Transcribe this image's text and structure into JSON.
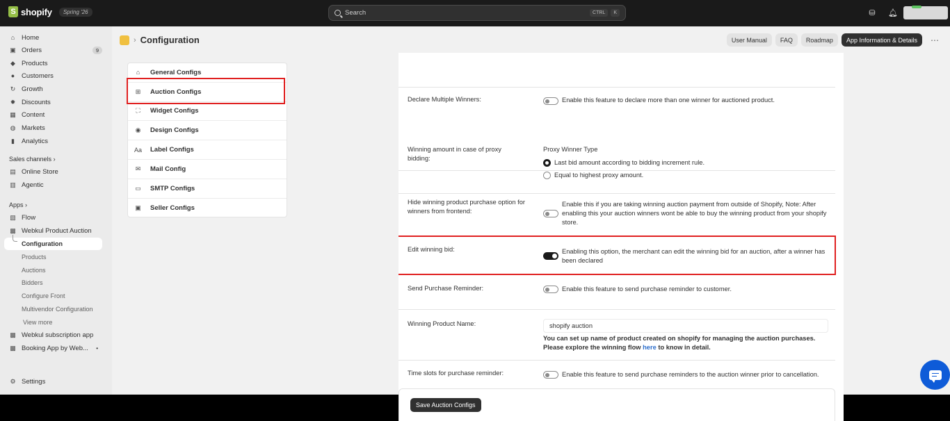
{
  "topbar": {
    "brand": "shopify",
    "edition": "Spring '26",
    "search_placeholder": "Search",
    "kbd": [
      "CTRL",
      "K"
    ]
  },
  "sidebar": {
    "items": [
      {
        "label": "Home",
        "icon": "home-icon"
      },
      {
        "label": "Orders",
        "icon": "orders-icon",
        "count": "9"
      },
      {
        "label": "Products",
        "icon": "products-icon"
      },
      {
        "label": "Customers",
        "icon": "customers-icon"
      },
      {
        "label": "Growth",
        "icon": "growth-icon"
      },
      {
        "label": "Discounts",
        "icon": "discounts-icon"
      },
      {
        "label": "Content",
        "icon": "content-icon"
      },
      {
        "label": "Markets",
        "icon": "markets-icon"
      },
      {
        "label": "Analytics",
        "icon": "analytics-icon"
      }
    ],
    "sales_channels_label": "Sales channels",
    "sales_channels": [
      {
        "label": "Online Store"
      },
      {
        "label": "Agentic"
      }
    ],
    "apps_label": "Apps",
    "apps": [
      {
        "label": "Flow"
      },
      {
        "label": "Webkul Product Auction"
      }
    ],
    "app_sub": [
      "Configuration",
      "Products",
      "Auctions",
      "Bidders",
      "Configure Front",
      "Multivendor Configuration",
      "View more"
    ],
    "other_apps": [
      {
        "label": "Webkul subscription app"
      },
      {
        "label": "Booking App by Web..."
      }
    ],
    "settings": "Settings"
  },
  "header": {
    "title": "Configuration",
    "buttons": [
      "User Manual",
      "FAQ",
      "Roadmap",
      "App Information & Details"
    ]
  },
  "config_menu": [
    {
      "label": "General Configs",
      "icon": "home-icon"
    },
    {
      "label": "Auction Configs",
      "icon": "cart-icon"
    },
    {
      "label": "Widget Configs",
      "icon": "widget-icon"
    },
    {
      "label": "Design Configs",
      "icon": "eye-icon"
    },
    {
      "label": "Label Configs",
      "icon": "label-icon"
    },
    {
      "label": "Mail Config",
      "icon": "mail-icon"
    },
    {
      "label": "SMTP Configs",
      "icon": "smtp-icon"
    },
    {
      "label": "Seller Configs",
      "icon": "seller-icon"
    }
  ],
  "settings": {
    "multiple_winners": {
      "label": "Declare Multiple Winners:",
      "desc": "Enable this feature to declare more than one winner for auctioned product.",
      "enabled": false
    },
    "proxy": {
      "label": "Winning amount in case of proxy bidding:",
      "title": "Proxy Winner Type",
      "options": [
        "Last bid amount according to bidding increment rule.",
        "Equal to highest proxy amount."
      ],
      "selected": 0
    },
    "hide_purchase": {
      "label": "Hide winning product purchase option for winners from frontend:",
      "desc": "Enable this if you are taking winning auction payment from outside of Shopify, Note: After enabling this your auction winners wont be able to buy the winning product from your shopify store.",
      "enabled": false
    },
    "edit_bid": {
      "label": "Edit winning bid:",
      "desc": "Enabling this option, the merchant can edit the winning bid for an auction, after a winner has been declared",
      "enabled": true
    },
    "reminder": {
      "label": "Send Purchase Reminder:",
      "desc": "Enable this feature to send purchase reminder to customer.",
      "enabled": false
    },
    "product_name": {
      "label": "Winning Product Name:",
      "value": "shopify auction",
      "note1": "You can set up name of product created on shopify for managing the auction purchases.",
      "note2a": "Please explore the winning flow",
      "note2link": "here",
      "note2b": "to know in detail."
    },
    "time_slots": {
      "label": "Time slots for purchase reminder:",
      "desc": "Enable this feature to send purchase reminders to the auction winner prior to cancellation.",
      "enabled": false
    }
  },
  "save_label": "Save Auction Configs"
}
